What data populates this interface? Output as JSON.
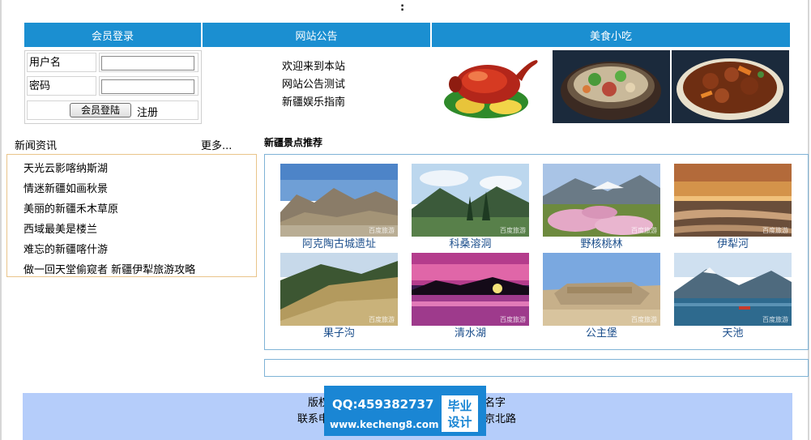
{
  "top_text": ":",
  "header": {
    "login": "会员登录",
    "notice": "网站公告",
    "food": "美食小吃"
  },
  "login": {
    "username_label": "用户名",
    "password_label": "密码",
    "username_value": "",
    "password_value": "",
    "login_button": "会员登陆",
    "register_link": "注册"
  },
  "notices": [
    "欢迎来到本站",
    "网站公告测试",
    "新疆娱乐指南"
  ],
  "food_images": [
    "roast-duck-image",
    "noodle-soup-image",
    "braised-meat-image"
  ],
  "news": {
    "title": "新闻资讯",
    "more": "更多...",
    "items": [
      "天光云影喀纳斯湖",
      "情迷新疆如画秋景",
      "美丽的新疆禾木草原",
      "西域最美是楼兰",
      "难忘的新疆喀什游",
      "做一回天堂偷窥者  新疆伊犁旅游攻略"
    ]
  },
  "scenic": {
    "title": "新疆景点推荐",
    "spots": [
      {
        "name": "阿克陶古城遗址"
      },
      {
        "name": "科桑溶洞"
      },
      {
        "name": "野核桃林"
      },
      {
        "name": "伊犁河"
      },
      {
        "name": "果子沟"
      },
      {
        "name": "清水湖"
      },
      {
        "name": "公主堡"
      },
      {
        "name": "天池"
      }
    ],
    "watermark": "百度旅游"
  },
  "footer": {
    "line1_left": "版权",
    "line1_right": "名字",
    "line2_left": "联系申",
    "line2_right": "京北路"
  },
  "overlay": {
    "qq": "QQ:459382737",
    "url": "www.kecheng8.com",
    "badge_top": "毕业",
    "badge_bottom": "设计"
  },
  "colors": {
    "header_blue": "#1b8fd1",
    "footer_blue": "#b5cdfa",
    "news_border": "#e9c48a",
    "scenic_border": "#7fb3d6",
    "caption": "#1c4f8c"
  }
}
